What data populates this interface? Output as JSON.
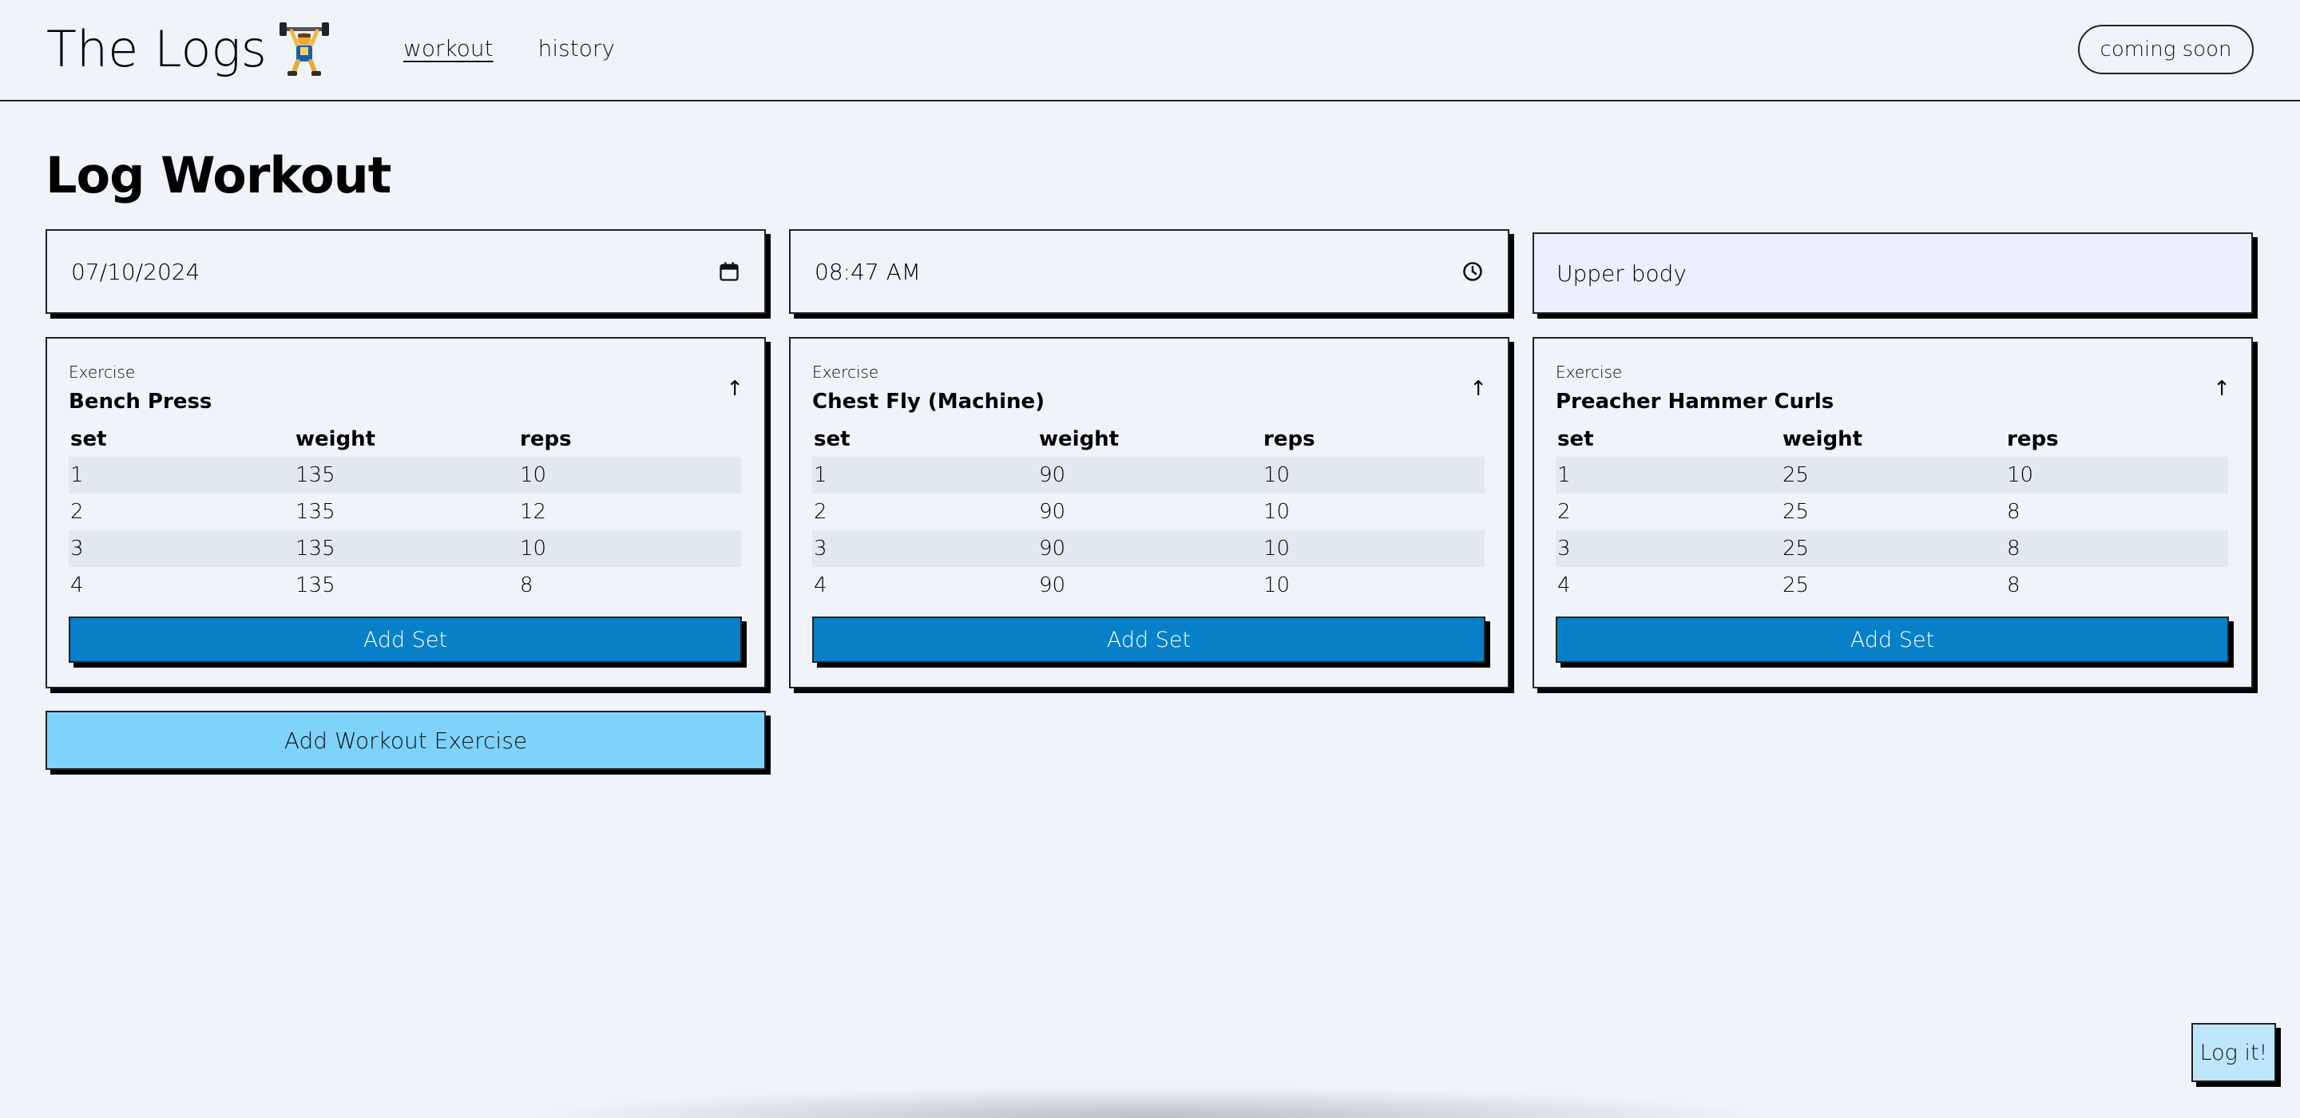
{
  "header": {
    "app_title": "The Logs",
    "logo_icon": "weightlifter-emoji-icon",
    "nav": [
      {
        "label": "workout",
        "active": true
      },
      {
        "label": "history",
        "active": false
      }
    ],
    "coming_soon_label": "coming soon"
  },
  "main": {
    "page_title": "Log Workout",
    "date_value": "07/10/2024",
    "date_icon": "calendar-icon",
    "time_value": "08:47 AM",
    "time_icon": "clock-icon",
    "workout_name": "Upper body",
    "exercise_label": "Exercise",
    "table_headers": [
      "set",
      "weight",
      "reps"
    ],
    "add_set_label": "Add Set",
    "collapse_icon": "arrow-up-icon",
    "collapse_glyph": "↑",
    "exercises": [
      {
        "name": "Bench Press",
        "sets": [
          {
            "set": "1",
            "weight": "135",
            "reps": "10"
          },
          {
            "set": "2",
            "weight": "135",
            "reps": "12"
          },
          {
            "set": "3",
            "weight": "135",
            "reps": "10"
          },
          {
            "set": "4",
            "weight": "135",
            "reps": "8"
          }
        ]
      },
      {
        "name": "Chest Fly (Machine)",
        "sets": [
          {
            "set": "1",
            "weight": "90",
            "reps": "10"
          },
          {
            "set": "2",
            "weight": "90",
            "reps": "10"
          },
          {
            "set": "3",
            "weight": "90",
            "reps": "10"
          },
          {
            "set": "4",
            "weight": "90",
            "reps": "10"
          }
        ]
      },
      {
        "name": "Preacher Hammer Curls",
        "sets": [
          {
            "set": "1",
            "weight": "25",
            "reps": "10"
          },
          {
            "set": "2",
            "weight": "25",
            "reps": "8"
          },
          {
            "set": "3",
            "weight": "25",
            "reps": "8"
          },
          {
            "set": "4",
            "weight": "25",
            "reps": "8"
          }
        ]
      }
    ],
    "add_exercise_label": "Add Workout Exercise",
    "log_it_label": "Log it!"
  },
  "colors": {
    "background": "#f0f4f9",
    "add_set_button": "#0780c8",
    "add_exercise_button": "#7ed3fb",
    "log_it_button": "#bde6fb",
    "stripe_row": "#e2e8f0",
    "text_input_bg": "#ebf0fc"
  }
}
